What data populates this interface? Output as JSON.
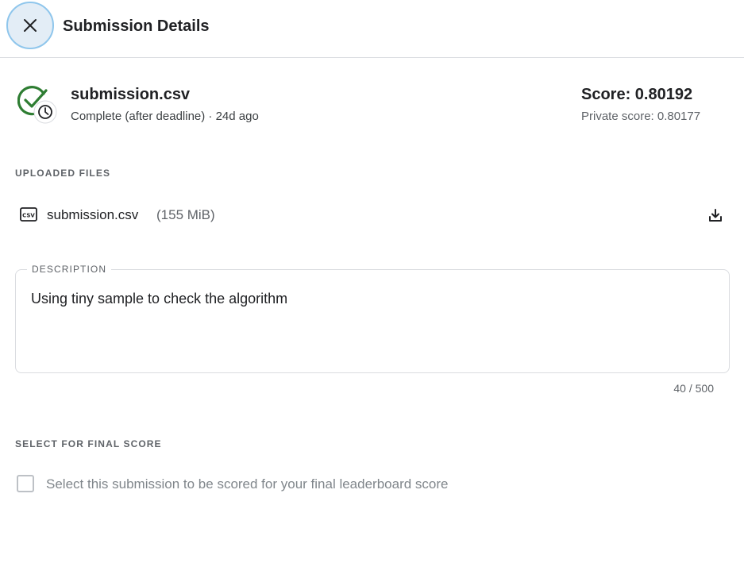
{
  "header": {
    "title": "Submission Details",
    "close_icon": "close-icon"
  },
  "submission": {
    "file_name": "submission.csv",
    "status": "Complete (after deadline) · 24d ago",
    "status_icon": "check-circle-clock-icon",
    "score": "Score: 0.80192",
    "private_score": "Private score: 0.80177"
  },
  "uploaded_files": {
    "label": "UPLOADED FILES",
    "files": [
      {
        "icon": "csv-file-icon",
        "name": "submission.csv",
        "size": "(155 MiB)",
        "action_icon": "download-icon"
      }
    ]
  },
  "description": {
    "label": "DESCRIPTION",
    "value": "Using tiny sample to check the algorithm",
    "char_count": "40 / 500"
  },
  "final_score": {
    "label": "SELECT FOR FINAL SCORE",
    "checkbox_label": "Select this submission to be scored for your final leaderboard score",
    "checked": false
  },
  "colors": {
    "success_green": "#2e7d32",
    "close_ring": "#8fc6ec",
    "close_bg": "#e3edf6",
    "text_primary": "#202124",
    "text_secondary": "#5f6368"
  }
}
